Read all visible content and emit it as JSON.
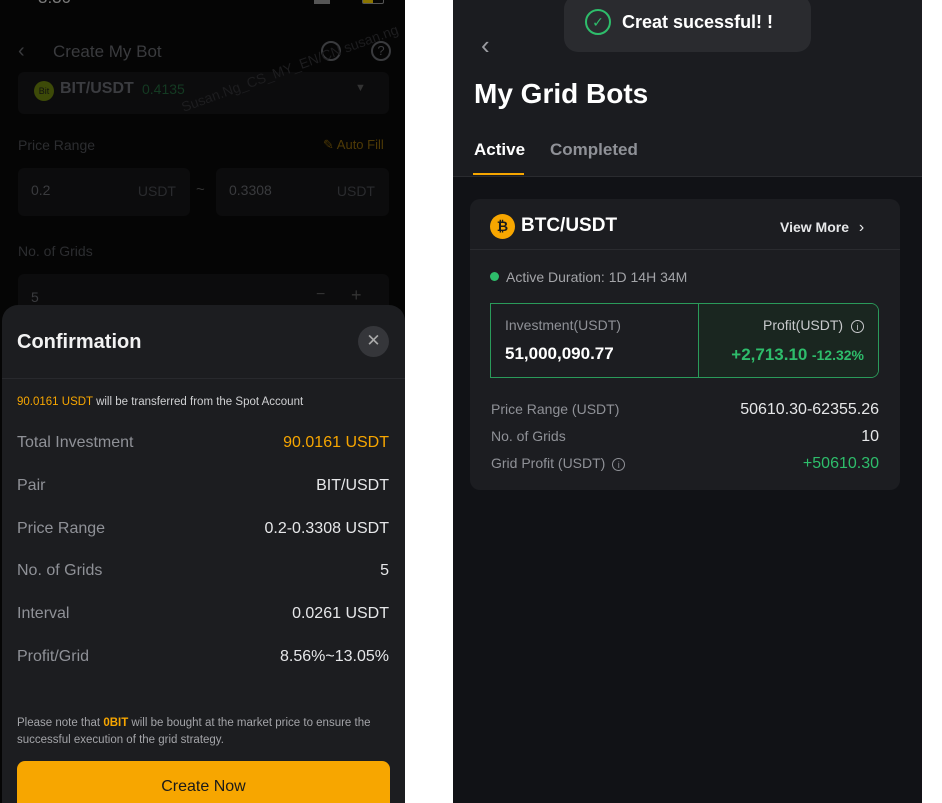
{
  "left": {
    "status_time": "3:30",
    "header_title": "Create My Bot",
    "pair": {
      "icon_text": "Bit",
      "name": "BIT/USDT",
      "price": "0.4135"
    },
    "price_range_label": "Price Range",
    "auto_fill": "Auto Fill",
    "min_price": "0.2",
    "max_price": "0.3308",
    "unit": "USDT",
    "tilde": "~",
    "grids_label": "No. of Grids",
    "grids_value": "5",
    "watermark": "Susan.Ng_CS_MY_EN/CN susan.ng",
    "confirmation": {
      "title": "Confirmation",
      "transfer_amount": "90.0161 USDT",
      "transfer_text": " will be transferred from the Spot Account",
      "rows": [
        {
          "label": "Total Investment",
          "value": "90.0161 USDT"
        },
        {
          "label": "Pair",
          "value": "BIT/USDT"
        },
        {
          "label": "Price Range",
          "value": "0.2-0.3308 USDT"
        },
        {
          "label": "No. of Grids",
          "value": "5"
        },
        {
          "label": "Interval",
          "value": "0.0261 USDT"
        },
        {
          "label": "Profit/Grid",
          "value": "8.56%~13.05%"
        }
      ],
      "note_pre": "Please note that ",
      "note_hl": "0BIT",
      "note_post": " will be bought at the market price to ensure the successful execution of the grid strategy.",
      "button": "Create Now"
    }
  },
  "right": {
    "toast": "Creat sucessful! !",
    "title": "My Grid Bots",
    "tabs": [
      {
        "label": "Active",
        "active": true
      },
      {
        "label": "Completed",
        "active": false
      }
    ],
    "card": {
      "pair": "BTC/USDT",
      "view_more": "View More",
      "duration": "Active Duration: 1D 14H 34M",
      "investment_label": "Investment(USDT)",
      "investment_value": "51,000,090.77",
      "profit_label": "Profit(USDT)",
      "profit_value": "+2,713.10",
      "profit_pct": "-12.32%",
      "details": [
        {
          "label": "Price Range (USDT)",
          "value": "50610.30-62355.26"
        },
        {
          "label": "No. of Grids",
          "value": "10"
        },
        {
          "label": "Grid Profit (USDT)",
          "value": "+50610.30"
        }
      ]
    }
  },
  "colors": {
    "accent": "#f7a600",
    "green": "#2ebd6b"
  }
}
